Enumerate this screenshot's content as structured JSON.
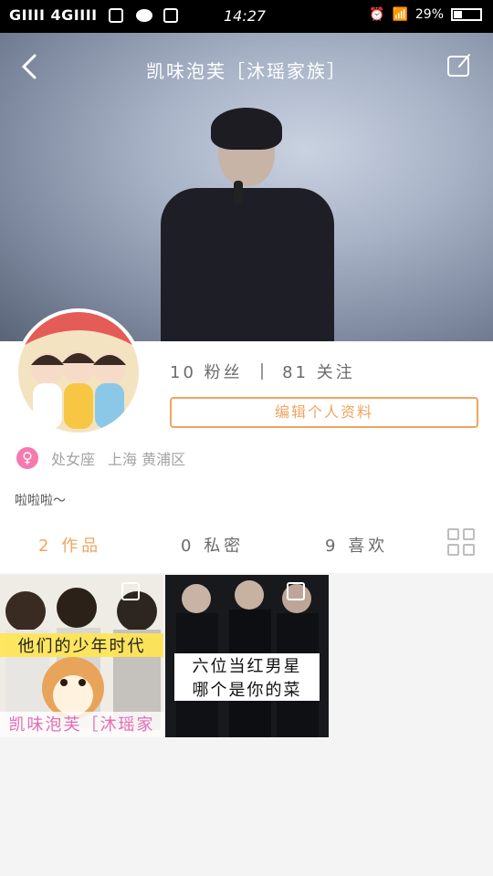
{
  "status_bar": {
    "left": "GIIII 4GIIII",
    "time": "14:27",
    "battery": "29%"
  },
  "header": {
    "title": "凯味泡芙［沐瑶家族］"
  },
  "profile": {
    "fans_count": "10",
    "fans_label": "粉丝",
    "following_count": "81",
    "following_label": "关注",
    "edit_label": "编辑个人资料",
    "zodiac": "处女座",
    "location": "上海 黄浦区",
    "bio": "啦啦啦～"
  },
  "tabs": [
    {
      "count": "2",
      "label": "作品"
    },
    {
      "count": "0",
      "label": "私密"
    },
    {
      "count": "9",
      "label": "喜欢"
    }
  ],
  "works": [
    {
      "caption_top": "他们的少年时代",
      "caption_bottom": "凯味泡芙［沐瑶家族］"
    },
    {
      "caption_top": "六位当红男星",
      "caption_bottom": "哪个是你的菜"
    }
  ],
  "colors": {
    "accent": "#f0a45f",
    "female": "#f57aaf"
  }
}
